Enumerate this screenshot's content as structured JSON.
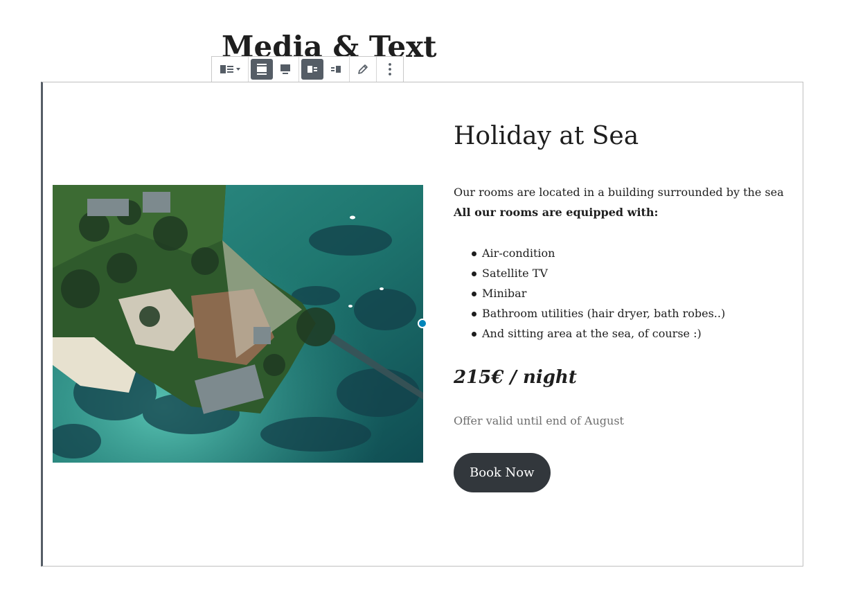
{
  "page": {
    "title": "Media & Text"
  },
  "toolbar": {
    "groups": [
      {
        "buttons": [
          {
            "name": "block-type-icon",
            "active": false,
            "has_dropdown": true
          }
        ]
      },
      {
        "buttons": [
          {
            "name": "align-wide-icon",
            "active": true
          },
          {
            "name": "align-full-icon",
            "active": false
          }
        ]
      },
      {
        "buttons": [
          {
            "name": "media-left-icon",
            "active": true
          },
          {
            "name": "media-right-icon",
            "active": false
          }
        ]
      },
      {
        "buttons": [
          {
            "name": "edit-pencil-icon",
            "active": false
          }
        ]
      },
      {
        "buttons": [
          {
            "name": "more-options-icon",
            "active": false
          }
        ]
      }
    ]
  },
  "content": {
    "heading": "Holiday at Sea",
    "intro_line": "Our rooms are located in a building surrounded by the sea",
    "equipped_label": "All our rooms are equipped with:",
    "amenities": [
      "Air-condition",
      "Satellite TV",
      "Minibar",
      "Bathroom utilities (hair dryer, bath robes..)",
      "And sitting area at the sea, of course :)"
    ],
    "price": "215€ / night",
    "offer": "Offer valid until end of August",
    "button_label": "Book Now"
  },
  "colors": {
    "toolbar_active": "#555d66",
    "button_bg": "#32373c",
    "handle": "#0085ba",
    "muted_text": "#6e6e6e"
  }
}
